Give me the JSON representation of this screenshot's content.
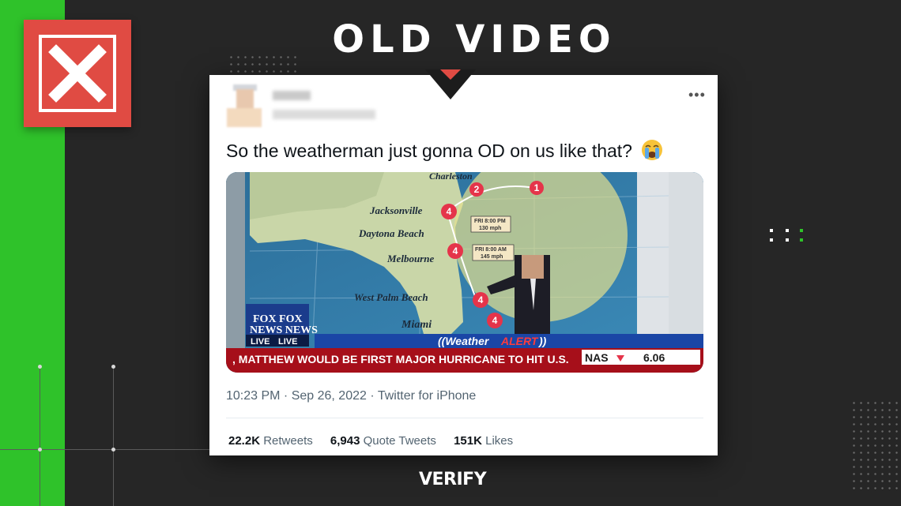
{
  "header": {
    "title": "OLD VIDEO",
    "verdict_icon": "x-mark-icon"
  },
  "tweet": {
    "text": "So the weatherman just gonna OD on us like that?",
    "emoji": "crying-face-emoji",
    "timestamp": "10:23 PM · Sep 26, 2022 · Twitter for iPhone",
    "stats": {
      "retweets_count": "22.2K",
      "retweets_label": "Retweets",
      "quotes_count": "6,943",
      "quotes_label": "Quote Tweets",
      "likes_count": "151K",
      "likes_label": "Likes"
    },
    "more_icon": "more-dots-icon"
  },
  "video": {
    "cities": [
      "Charleston",
      "Jacksonville",
      "Daytona Beach",
      "Melbourne",
      "West Palm Beach",
      "Miami"
    ],
    "storm_markers": [
      "1",
      "2",
      "4",
      "4",
      "4",
      "4"
    ],
    "forecast_boxes": [
      "FRI 8:00 PM\n130 mph",
      "FRI 8:00 AM\n145 mph"
    ],
    "network_logo": "FOX NEWS",
    "live_label": "LIVE",
    "segment_label": "((Weather ALERT))",
    "ticker_text": ", MATTHEW WOULD BE FIRST MAJOR HURRICANE TO HIT U.S.",
    "market_symbol": "NAS",
    "market_value": "6.06"
  },
  "footer": {
    "brand": "VERIFY"
  },
  "colors": {
    "accent_green": "#2fc22a",
    "alert_red": "#e04b43",
    "background": "#262626"
  }
}
